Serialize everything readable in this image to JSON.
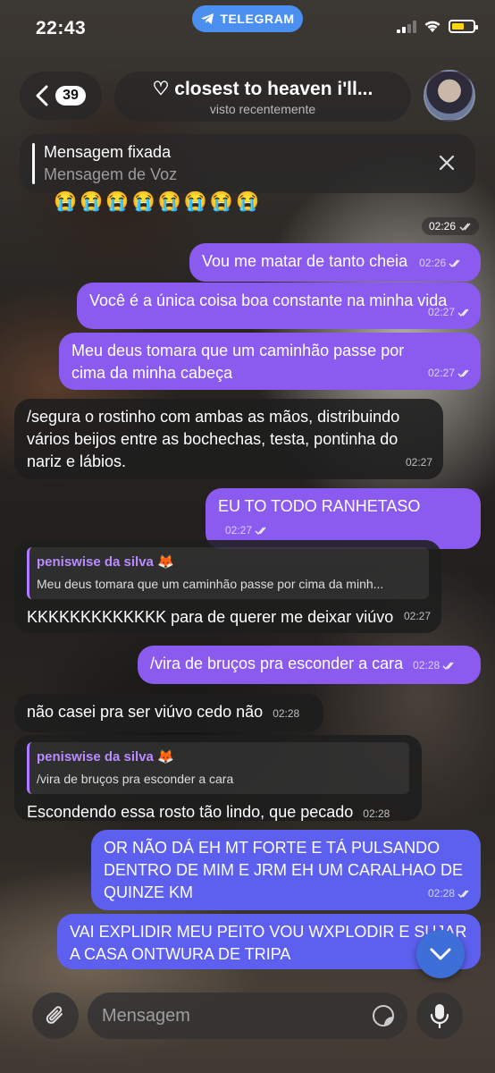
{
  "status_bar": {
    "time": "22:43",
    "app_label": "TELEGRAM"
  },
  "header": {
    "back_count": "39",
    "title": "♡ closest to heaven i'll...",
    "subtitle": "visto recentemente"
  },
  "pinned": {
    "title": "Mensagem fixada",
    "subtitle": "Mensagem de Voz"
  },
  "emoji_row": "😭😭😭😭😭😭😭😭",
  "messages": [
    {
      "time": "02:26"
    },
    {
      "text": "Vou me matar de tanto cheia",
      "time": "02:26"
    },
    {
      "text": "Você é a única coisa boa constante na minha vida",
      "time": "02:27"
    },
    {
      "text": "Meu deus tomara que um caminhão passe por cima da minha cabeça",
      "time": "02:27"
    },
    {
      "text": "/segura o rostinho com ambas as mãos, distribuindo vários beijos entre as bochechas, testa, pontinha do nariz e lábios.",
      "time": "02:27"
    },
    {
      "text": "EU TO TODO RANHETASO",
      "time": "02:27"
    },
    {
      "reply_name": "peniswise da silva 🦊",
      "reply_text": "Meu deus tomara que um caminhão passe por cima da minh...",
      "text": "KKKKKKKKKKKKK para de querer me deixar viúvo",
      "time": "02:27"
    },
    {
      "text": "/vira de bruços pra esconder a cara",
      "time": "02:28"
    },
    {
      "text": "não casei pra ser viúvo cedo não",
      "time": "02:28"
    },
    {
      "reply_name": "peniswise da silva 🦊",
      "reply_text": "/vira de bruços pra esconder a cara",
      "text": "Escondendo essa rosto tão lindo, que pecado",
      "time": "02:28"
    },
    {
      "text": "OR NÃO DÁ EH MT FORTE E TÁ PULSANDO DENTRO DE MIM E JRM EH UM CARALHAO DE QUINZE KM",
      "time": "02:28"
    },
    {
      "text": "VAI EXPLIDIR MEU PEITO VOU WXPLODIR E SUJAR A CASA ONTWURA DE TRIPA"
    }
  ],
  "composer": {
    "placeholder": "Mensagem"
  },
  "colors": {
    "outgoing": "#8b5bf0",
    "outgoing_blue": "#5d60ee",
    "incoming": "#1e1e1e",
    "accent": "#4b8ff0"
  }
}
